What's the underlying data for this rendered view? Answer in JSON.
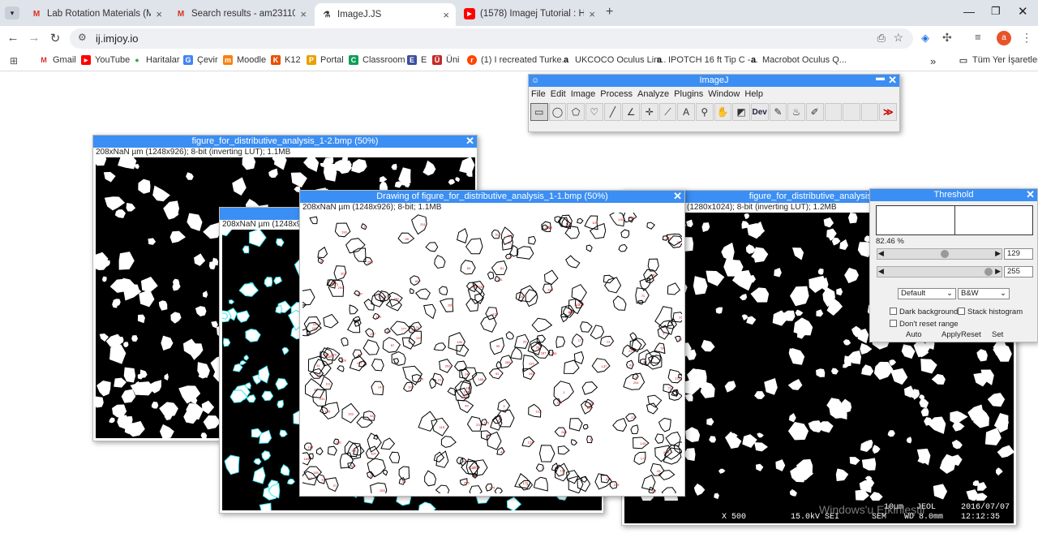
{
  "tabs": [
    {
      "label": "Lab Rotation Materials (May 8...",
      "icon": "gmail-icon",
      "color": "#d93025"
    },
    {
      "label": "Search results - am23110@shil...",
      "icon": "gmail-icon",
      "color": "#d93025"
    },
    {
      "label": "ImageJ.JS",
      "icon": "imagej-icon",
      "color": "#333"
    },
    {
      "label": "(1578) Imagej Tutorial : How to...",
      "icon": "youtube-icon",
      "color": "#ff0000"
    }
  ],
  "address": "ij.imjoy.io",
  "profile_initial": "a",
  "bookmarks": [
    "Gmail",
    "YouTube",
    "Haritalar",
    "Çevir",
    "Moodle",
    "K12",
    "Portal",
    "Classroom",
    "E",
    "Üni",
    "(1) I recreated Turke...",
    "UKCOCO Oculus Lin...",
    "IPOTCH 16 ft Tip C -...",
    "Macrobot Oculus Q..."
  ],
  "all_bookmarks": "Tüm Yer İşaretleri",
  "imagej": {
    "title": "ImageJ",
    "menu": [
      "File",
      "Edit",
      "Image",
      "Process",
      "Analyze",
      "Plugins",
      "Window",
      "Help"
    ],
    "dev_label": "Dev"
  },
  "win1": {
    "title": "figure_for_distributive_analysis_1-2.bmp (50%)",
    "info": "208xNaN µm (1248x926); 8-bit (inverting LUT); 1.1MB"
  },
  "win2": {
    "info": "208xNaN µm (1248x9"
  },
  "win3": {
    "title": "Drawing of figure_for_distributive_analysis_1-1.bmp (50%)",
    "info": "208xNaN µm (1248x926); 8-bit; 1.1MB"
  },
  "win4": {
    "title": "figure_for_distributive_analysis_1.b",
    "info": "(1280x1024); 8-bit (inverting LUT); 1.2MB",
    "footer": {
      "scale": "10µm",
      "brand": "JEOL",
      "date": "2016/07/07",
      "mag": "X 500",
      "kv": "15.0kV SEI",
      "sem": "SEM",
      "wd": "WD 8.0mm",
      "time": "12:12:35"
    }
  },
  "threshold": {
    "title": "Threshold",
    "percent": "82.46 %",
    "min": "129",
    "max": "255",
    "method": "Default",
    "mode": "B&W",
    "dark_bg": "Dark background",
    "stack_hist": "Stack histogram",
    "dont_reset": "Don't reset range",
    "buttons": [
      "Auto",
      "Apply",
      "Reset",
      "Set"
    ]
  },
  "watermark": "Windows'u Etkinleştir"
}
